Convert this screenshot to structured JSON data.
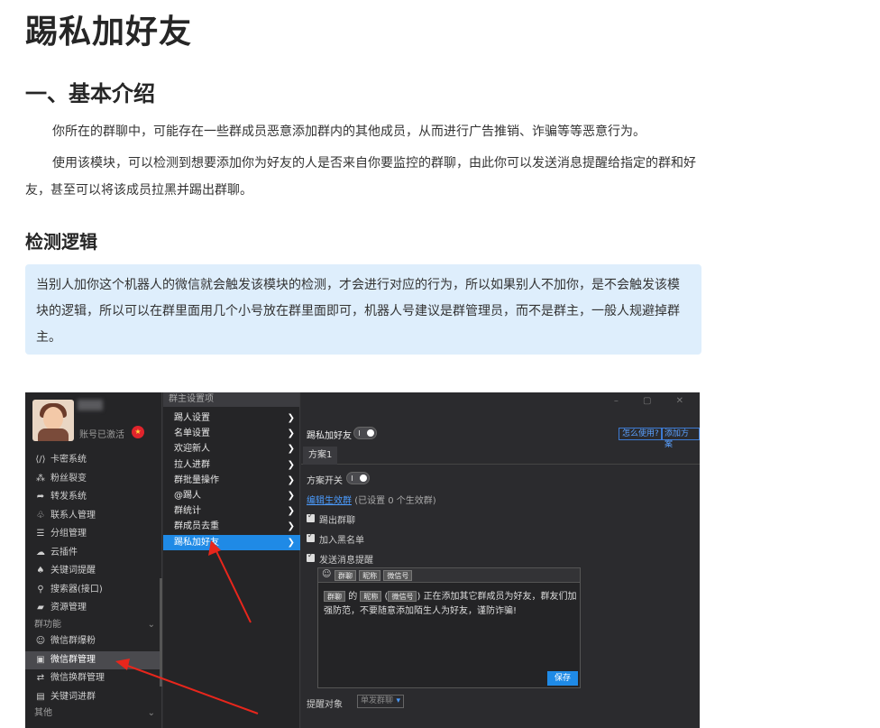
{
  "page": {
    "title": "踢私加好友",
    "section1_heading": "一、基本介绍",
    "para1": "你所在的群聊中，可能存在一些群成员恶意添加群内的其他成员，从而进行广告推销、诈骗等等恶意行为。",
    "para2": "使用该模块，可以检测到想要添加你为好友的人是否来自你要监控的群聊，由此你可以发送消息提醒给指定的群和好友，甚至可以将该成员拉黑并踢出群聊。",
    "section2_heading": "检测逻辑",
    "note": "当别人加你这个机器人的微信就会触发该模块的检测，才会进行对应的行为，所以如果别人不加你，是不会触发该模块的逻辑，所以可以在群里面用几个小号放在群里面即可，机器人号建议是群管理员，而不是群主，一般人规避掉群主。"
  },
  "app": {
    "account_status": "账号已激活",
    "menu": [
      {
        "icon": "code-icon",
        "glyph": "⟨/⟩",
        "label": "卡密系统"
      },
      {
        "icon": "fans-icon",
        "glyph": "⁂",
        "label": "粉丝裂变"
      },
      {
        "icon": "forward-icon",
        "glyph": "➦",
        "label": "转发系统"
      },
      {
        "icon": "contacts-icon",
        "glyph": "♧",
        "label": "联系人管理"
      },
      {
        "icon": "group-list-icon",
        "glyph": "☰",
        "label": "分组管理"
      },
      {
        "icon": "cloud-icon",
        "glyph": "☁",
        "label": "云插件"
      },
      {
        "icon": "bell-icon",
        "glyph": "♠",
        "label": "关键词提醒"
      },
      {
        "icon": "search-icon",
        "glyph": "⚲",
        "label": "搜索器(接口)"
      },
      {
        "icon": "folder-icon",
        "glyph": "▰",
        "label": "资源管理"
      }
    ],
    "section_group": "群功能",
    "group_menu": [
      {
        "icon": "add-user-icon",
        "glyph": "☺",
        "label": "微信群爆粉"
      },
      {
        "icon": "briefcase-icon",
        "glyph": "▣",
        "label": "微信群管理"
      },
      {
        "icon": "swap-icon",
        "glyph": "⇄",
        "label": "微信换群管理"
      },
      {
        "icon": "keyword-group-icon",
        "glyph": "▤",
        "label": "关键词进群"
      }
    ],
    "section_other": "其他",
    "sub_title": "群主设置项",
    "sub_menu": [
      "踢人设置",
      "名单设置",
      "欢迎新人",
      "拉人进群",
      "群批量操作",
      "@踢人",
      "群统计",
      "群成员去重",
      "踢私加好友"
    ],
    "panel_title": "踢私加好友",
    "help_button": "怎么使用?",
    "add_plan_button": "添加方案",
    "tab_plan": "方案1",
    "plan_switch": "方案开关",
    "edit_groups_link": "编辑生效群",
    "edit_groups_note": "(已设置 0 个生效群)",
    "checkboxes": [
      "踢出群聊",
      "加入黑名单",
      "发送消息提醒"
    ],
    "editor_chips": [
      "群聊",
      "昵称",
      "微信号"
    ],
    "editor_text_tail": "正在添加其它群成员为好友，群友们加强防范，不要随意添加陌生人为好友，谨防诈骗!",
    "editor_text_de": "的",
    "save_button": "保存",
    "remind_target_label": "提醒对象",
    "remind_target_value": "单发群聊",
    "window_controls": "– ▢ ✕"
  }
}
